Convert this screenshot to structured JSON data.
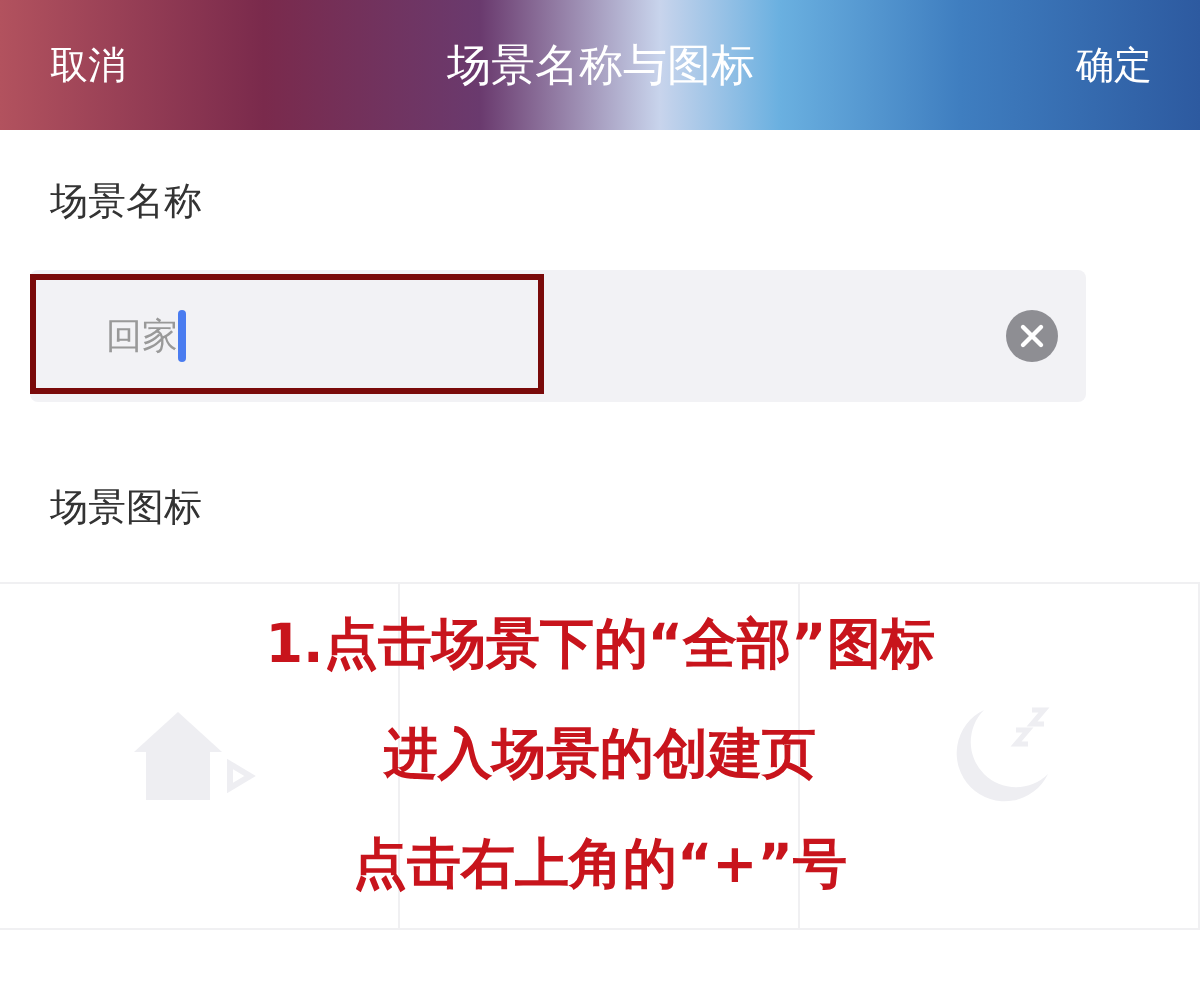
{
  "nav": {
    "cancel": "取消",
    "title": "场景名称与图标",
    "confirm": "确定"
  },
  "name_section": {
    "label": "场景名称",
    "value": "回家"
  },
  "icon_section": {
    "label": "场景图标",
    "icons": [
      {
        "kind": "house-arrow"
      },
      {
        "kind": "hidden"
      },
      {
        "kind": "moon"
      }
    ]
  },
  "caption": [
    "1.点击场景下的“全部”图标",
    "进入场景的创建页",
    "点击右上角的“+”号"
  ]
}
